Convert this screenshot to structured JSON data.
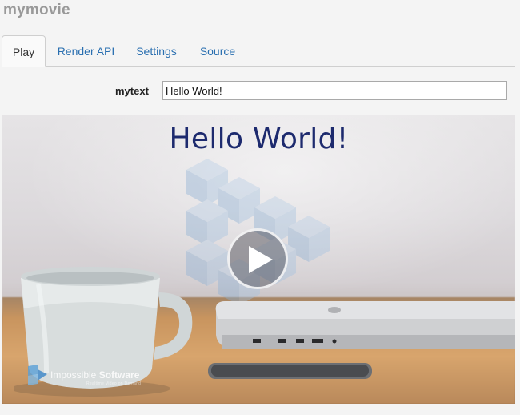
{
  "app": {
    "title": "mymovie"
  },
  "tabs": [
    {
      "label": "Play",
      "active": true
    },
    {
      "label": "Render API",
      "active": false
    },
    {
      "label": "Settings",
      "active": false
    },
    {
      "label": "Source",
      "active": false
    }
  ],
  "form": {
    "mytext_label": "mytext",
    "mytext_value": "Hello World!"
  },
  "video": {
    "headline": "Hello World!",
    "logo_text_light": "Impossible ",
    "logo_text_bold": "Software",
    "logo_tagline": "Realtime Video on Demand",
    "icons": [
      "play-icon",
      "cube-logo-icon",
      "impossible-logo-icon"
    ]
  },
  "colors": {
    "tab_link": "#2a6fb0",
    "headline": "#1d2a6e",
    "title_gray": "#999999"
  }
}
